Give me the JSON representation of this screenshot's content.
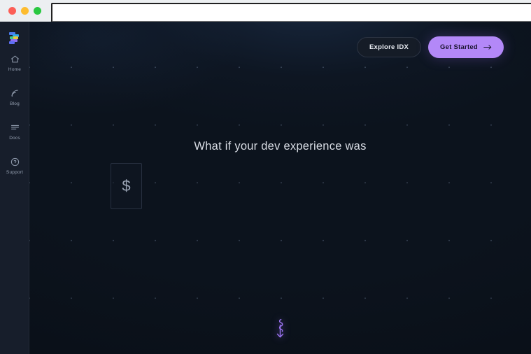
{
  "window": {
    "traffic_lights": [
      {
        "name": "close",
        "color": "#fc5f57"
      },
      {
        "name": "minimize",
        "color": "#fdbc2e"
      },
      {
        "name": "maximize",
        "color": "#29c840"
      }
    ],
    "address_value": "",
    "address_placeholder": ""
  },
  "sidebar": {
    "logo_name": "idx-logo",
    "items": [
      {
        "label": "Home",
        "icon": "home-icon"
      },
      {
        "label": "Blog",
        "icon": "rss-icon"
      },
      {
        "label": "Docs",
        "icon": "document-lines-icon"
      },
      {
        "label": "Support",
        "icon": "help-circle-icon"
      }
    ]
  },
  "header": {
    "explore_label": "Explore IDX",
    "get_started_label": "Get Started",
    "get_started_arrow": "arrow-right-icon"
  },
  "hero": {
    "headline": "What if your dev experience was",
    "card_glyph": "$",
    "scroll_icon": "squiggly-arrow-down-icon"
  },
  "colors": {
    "background": "#0c131d",
    "sidebar": "#171e2b",
    "accent_purple": "#b388f8",
    "text_primary": "#d9dde5",
    "text_muted": "#96a1b2"
  }
}
